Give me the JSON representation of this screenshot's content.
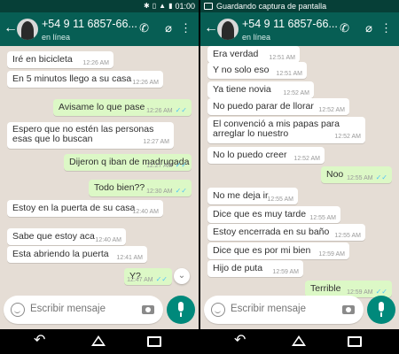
{
  "status": {
    "time": "01:00",
    "screenshot_text": "Guardando captura de pantalla"
  },
  "header": {
    "contact_name": "+54 9 11 6857-66...",
    "contact_status": "en línea",
    "back_icon": "back-arrow-icon",
    "call_icon": "phone-icon",
    "attach_icon": "paperclip-icon",
    "menu_icon": "more-vert-icon"
  },
  "left_chat": {
    "messages": [
      {
        "text": "Iré en bicicleta",
        "time": "12:26 AM",
        "dir": "in"
      },
      {
        "text": "En 5 minutos llego a su casa",
        "time": "12:26 AM",
        "dir": "in"
      },
      {
        "text": "Avisame lo que pase",
        "time": "12:26 AM",
        "dir": "out",
        "read": "✓✓"
      },
      {
        "text": "Espero que no estén las personas esas que lo buscan",
        "time": "12:27 AM",
        "dir": "in"
      },
      {
        "text": "Dijeron q iban de madrugada",
        "time": "12:27 AM",
        "dir": "out",
        "read": "✓✓"
      },
      {
        "text": "Todo bien??",
        "time": "12:30 AM",
        "dir": "out",
        "read": "✓✓"
      },
      {
        "text": "Estoy en la puerta de su casa",
        "time": "12:40 AM",
        "dir": "in"
      },
      {
        "text": "Sabe que estoy aca",
        "time": "12:40 AM",
        "dir": "in"
      },
      {
        "text": "Esta abriendo la puerta",
        "time": "12:41 AM",
        "dir": "in"
      },
      {
        "text": "Y?",
        "time": "12:47 AM",
        "dir": "out",
        "read": "✓✓"
      }
    ]
  },
  "right_chat": {
    "messages": [
      {
        "text": "Era verdad",
        "time": "12:51 AM",
        "dir": "in"
      },
      {
        "text": "Y no solo eso",
        "time": "12:51 AM",
        "dir": "in"
      },
      {
        "text": "Ya tiene novia",
        "time": "12:52 AM",
        "dir": "in"
      },
      {
        "text": "No puedo parar de llorar",
        "time": "12:52 AM",
        "dir": "in"
      },
      {
        "text": "El convenció a mis papas para arreglar lo nuestro",
        "time": "12:52 AM",
        "dir": "in"
      },
      {
        "text": "No lo puedo creer",
        "time": "12:52 AM",
        "dir": "in"
      },
      {
        "text": "Noo",
        "time": "12:55 AM",
        "dir": "out",
        "read": "✓✓"
      },
      {
        "text": "No me deja ir",
        "time": "12:55 AM",
        "dir": "in"
      },
      {
        "text": "Dice que es muy tarde",
        "time": "12:55 AM",
        "dir": "in"
      },
      {
        "text": "Estoy encerrada en su baño",
        "time": "12:55 AM",
        "dir": "in"
      },
      {
        "text": "Dice que es por mi bien",
        "time": "12:59 AM",
        "dir": "in"
      },
      {
        "text": "Hijo de puta",
        "time": "12:59 AM",
        "dir": "in"
      },
      {
        "text": "Terrible",
        "time": "12:59 AM",
        "dir": "out",
        "read": "✓✓"
      }
    ]
  },
  "composer": {
    "placeholder": "Escribir mensaje",
    "emoji_icon": "emoji-icon",
    "camera_icon": "camera-icon",
    "mic_icon": "mic-icon"
  },
  "nav": {
    "back_icon": "nav-back-icon",
    "home_icon": "nav-home-icon",
    "recent_icon": "nav-recent-icon"
  },
  "scroll_down_icon": "chevron-down-icon",
  "colors": {
    "header": "#075e54",
    "status_bar": "#063f37",
    "chat_bg": "#e5ddd5",
    "outgoing_bubble": "#dcf8c6",
    "incoming_bubble": "#ffffff",
    "read_ticks": "#4fc3f7",
    "fab": "#00897b"
  }
}
